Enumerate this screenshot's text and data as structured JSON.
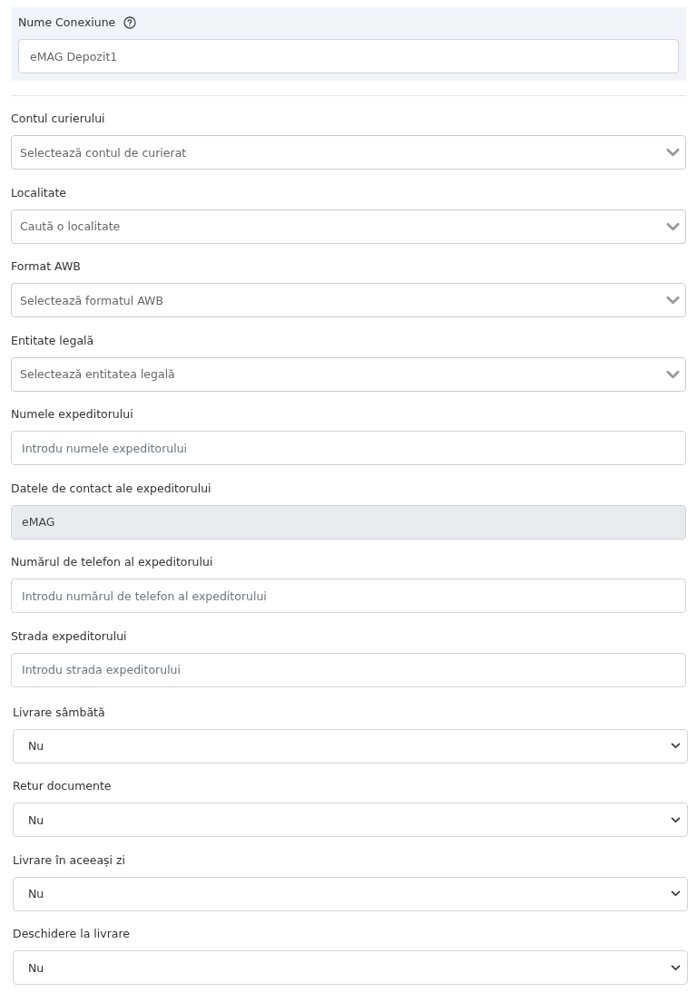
{
  "connection": {
    "label": "Nume Conexiune",
    "value": "eMAG Depozit1"
  },
  "fields": [
    {
      "kind": "select",
      "label": "Contul curierului",
      "placeholder": "Selectează contul de curierat"
    },
    {
      "kind": "select",
      "label": "Localitate",
      "placeholder": "Caută o localitate"
    },
    {
      "kind": "select",
      "label": "Format AWB",
      "placeholder": "Selectează formatul AWB"
    },
    {
      "kind": "select",
      "label": "Entitate legală",
      "placeholder": "Selectează entitatea legală"
    },
    {
      "kind": "text",
      "label": "Numele expeditorului",
      "placeholder": "Introdu numele expeditorului"
    },
    {
      "kind": "readonly",
      "label": "Datele de contact ale expeditorului",
      "value": "eMAG"
    },
    {
      "kind": "text",
      "label": "Numărul de telefon al expeditorului",
      "placeholder": "Introdu numărul de telefon al expeditorului"
    },
    {
      "kind": "text",
      "label": "Strada expeditorului",
      "placeholder": "Introdu strada expeditorului"
    }
  ],
  "options": [
    {
      "label": "Livrare sâmbătă",
      "value": "Nu"
    },
    {
      "label": "Retur documente",
      "value": "Nu"
    },
    {
      "label": "Livrare în aceeași zi",
      "value": "Nu"
    },
    {
      "label": "Deschidere la livrare",
      "value": "Nu"
    }
  ]
}
